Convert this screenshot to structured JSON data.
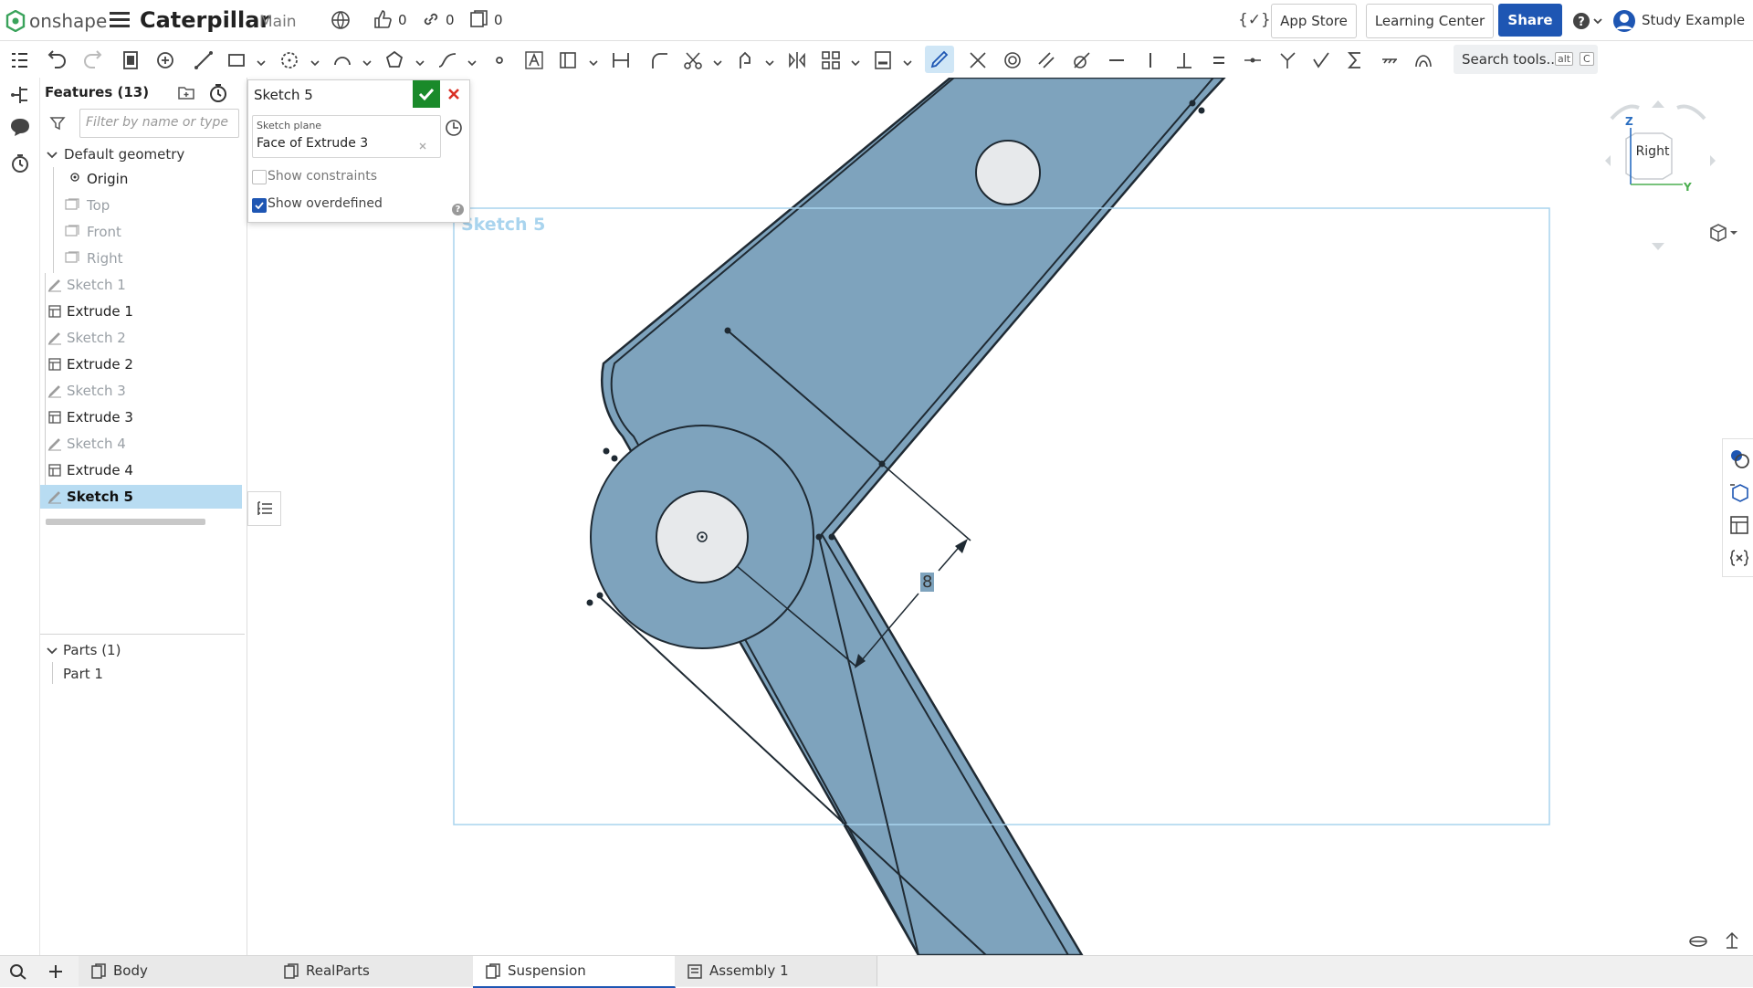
{
  "app": {
    "brand": "onshape",
    "document_title": "Caterpillar",
    "workspace": "Main",
    "likes": "0",
    "links": "0",
    "copies": "0",
    "app_store": "App Store",
    "learning_center": "Learning Center",
    "share": "Share",
    "user": "Study Example"
  },
  "toolbar": {
    "search_placeholder": "Search tools...",
    "shortcut_alt": "alt",
    "shortcut_key": "C"
  },
  "features": {
    "header": "Features (13)",
    "filter_placeholder": "Filter by name or type",
    "default_geometry": "Default geometry",
    "items": [
      {
        "label": "Origin",
        "style": "normal",
        "kind": "origin",
        "indent": true
      },
      {
        "label": "Top",
        "style": "dim",
        "kind": "plane",
        "indent": true
      },
      {
        "label": "Front",
        "style": "dim",
        "kind": "plane",
        "indent": true
      },
      {
        "label": "Right",
        "style": "dim",
        "kind": "plane",
        "indent": true
      },
      {
        "label": "Sketch 1",
        "style": "dim",
        "kind": "sketch",
        "indent": false
      },
      {
        "label": "Extrude 1",
        "style": "normal",
        "kind": "extrude",
        "indent": false
      },
      {
        "label": "Sketch 2",
        "style": "dim",
        "kind": "sketch",
        "indent": false
      },
      {
        "label": "Extrude 2",
        "style": "normal",
        "kind": "extrude",
        "indent": false
      },
      {
        "label": "Sketch 3",
        "style": "dim",
        "kind": "sketch",
        "indent": false
      },
      {
        "label": "Extrude 3",
        "style": "normal",
        "kind": "extrude",
        "indent": false
      },
      {
        "label": "Sketch 4",
        "style": "dim",
        "kind": "sketch",
        "indent": false
      },
      {
        "label": "Extrude 4",
        "style": "normal",
        "kind": "extrude",
        "indent": false
      },
      {
        "label": "Sketch 5",
        "style": "selected",
        "kind": "sketch",
        "indent": false
      }
    ],
    "parts_header": "Parts (1)",
    "parts": [
      "Part 1"
    ]
  },
  "sketch_dialog": {
    "title": "Sketch 5",
    "plane_label": "Sketch plane",
    "plane_value": "Face of Extrude 3",
    "show_constraints": "Show constraints",
    "show_constraints_checked": false,
    "show_overdefined": "Show overdefined",
    "show_overdefined_checked": true
  },
  "viewport": {
    "sketch_label": "Sketch 5",
    "dimension": "8",
    "view_cube": "Right",
    "axis_z": "Z",
    "axis_y": "Y"
  },
  "tabs": [
    {
      "label": "Body",
      "active": false
    },
    {
      "label": "RealParts",
      "active": false
    },
    {
      "label": "Suspension",
      "active": true
    },
    {
      "label": "Assembly 1",
      "active": false
    }
  ],
  "colors": {
    "part_fill": "#7ea3bd",
    "accent": "#1e56b3",
    "confirm": "#1a8a2a",
    "cancel": "#d93025",
    "sketch_frame": "#a9d4ee"
  }
}
